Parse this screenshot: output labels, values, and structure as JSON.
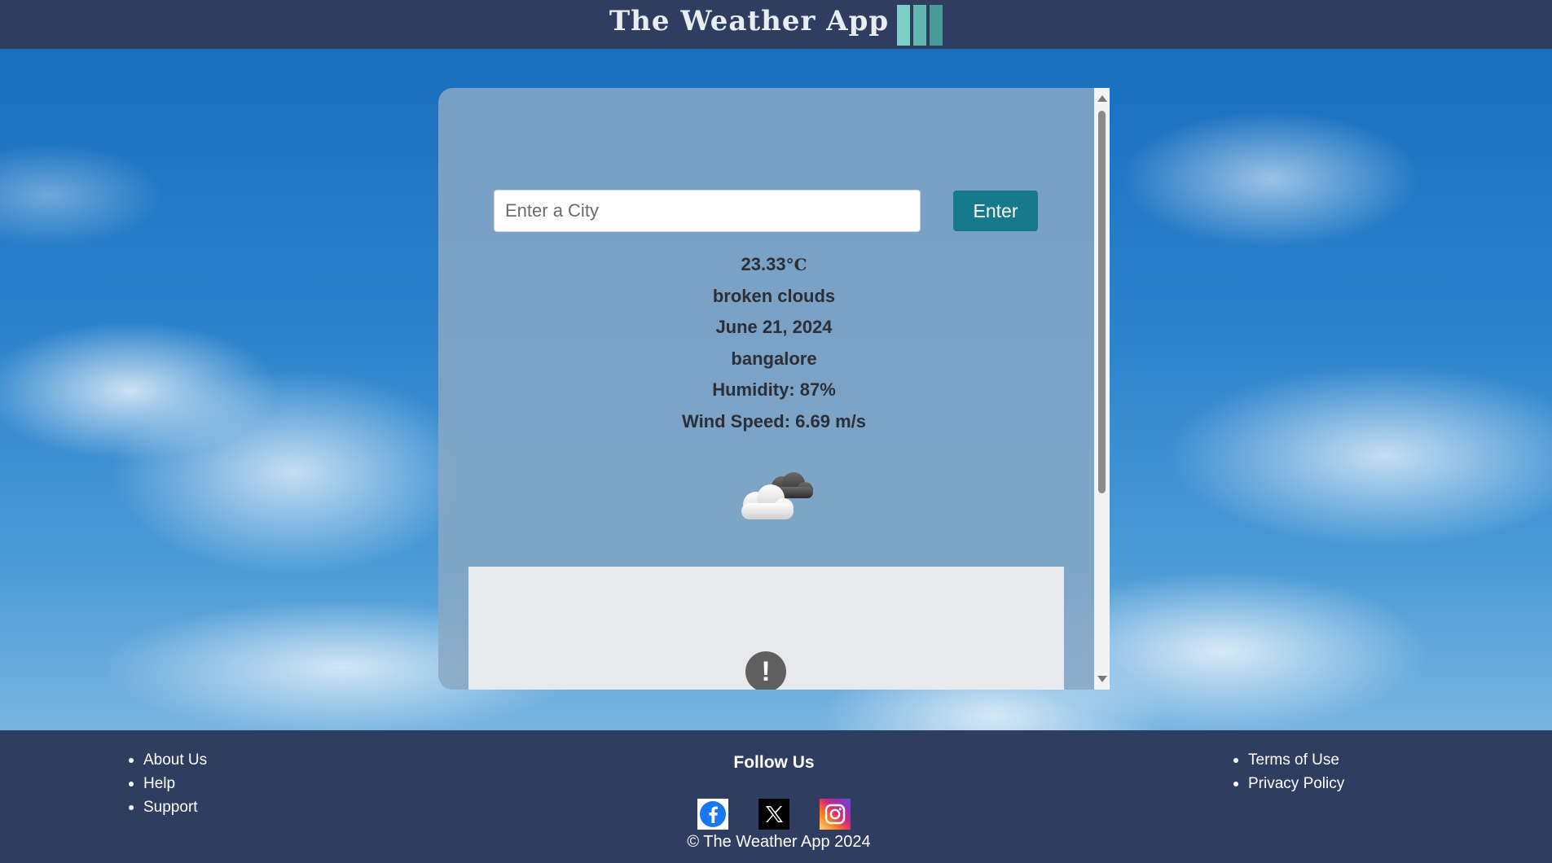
{
  "header": {
    "title": "The Weather App"
  },
  "search": {
    "placeholder": "Enter a City",
    "value": "",
    "button_label": "Enter"
  },
  "weather": {
    "temperature": "23.33",
    "temperature_unit": "°C",
    "description": "broken clouds",
    "date": "June 21, 2024",
    "city": "bangalore",
    "humidity": "Humidity: 87%",
    "wind_speed": "Wind Speed: 6.69 m/s",
    "icon": "broken-clouds-icon"
  },
  "ad": {
    "icon": "alert-icon",
    "symbol": "!"
  },
  "footer": {
    "left_links": [
      "About Us",
      "Help",
      "Support"
    ],
    "follow_title": "Follow Us",
    "social": [
      "facebook-icon",
      "x-icon",
      "instagram-icon"
    ],
    "right_links": [
      "Terms of Use",
      "Privacy Policy"
    ],
    "copyright": "© The Weather App 2024"
  },
  "colors": {
    "header_bg": "#2f3d61",
    "button_bg": "#167a8c",
    "card_bg": "#8aa8c4"
  }
}
